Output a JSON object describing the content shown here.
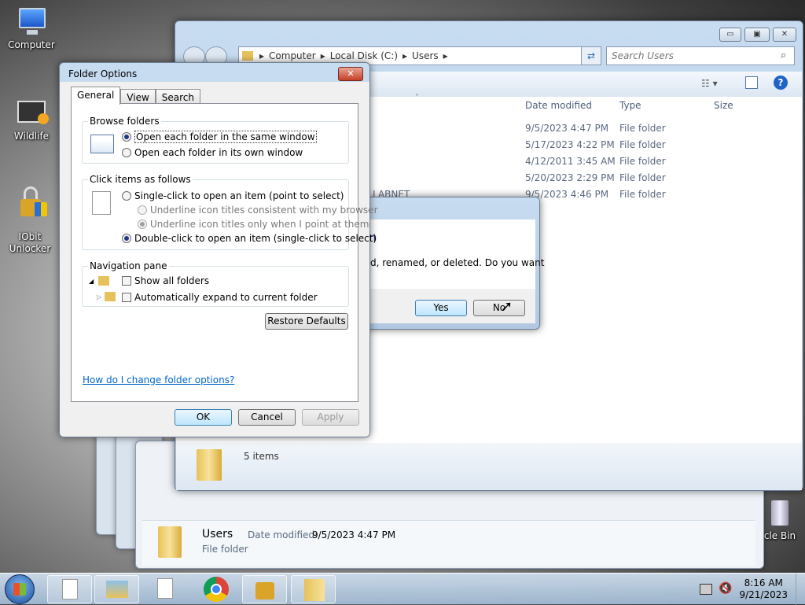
{
  "desktop": {
    "icons": [
      {
        "label": "Computer"
      },
      {
        "label": "Wildlife"
      },
      {
        "label": "IObit\nUnlocker"
      },
      {
        "label": "cle Bin"
      }
    ]
  },
  "explorer": {
    "breadcrumb": [
      "Computer",
      "Local Disk (C:)",
      "Users"
    ],
    "search_placeholder": "Search Users",
    "columns": {
      "date": "Date modified",
      "type": "Type",
      "size": "Size"
    },
    "rows": [
      {
        "name": "",
        "date": "9/5/2023 4:47 PM",
        "type": "File folder"
      },
      {
        "name": "",
        "date": "5/17/2023 4:22 PM",
        "type": "File folder"
      },
      {
        "name": "",
        "date": "4/12/2011 3:45 AM",
        "type": "File folder"
      },
      {
        "name": "",
        "date": "5/20/2023 2:29 PM",
        "type": "File folder"
      },
      {
        "name": "LABNET",
        "date": "9/5/2023 4:46 PM",
        "type": "File folder"
      }
    ],
    "status": "5 items"
  },
  "back_window": {
    "name": "Users",
    "modified_label": "Date modified:",
    "modified_value": "9/5/2023 4:47 PM",
    "type": "File folder"
  },
  "confirm": {
    "title_fragment": "n",
    "message_fragment": "d, renamed, or deleted. Do you want",
    "yes": "Yes",
    "no": "No"
  },
  "folder_options": {
    "title": "Folder Options",
    "tabs": [
      "General",
      "View",
      "Search"
    ],
    "browse": {
      "title": "Browse folders",
      "opt1": "Open each folder in the same window",
      "opt2": "Open each folder in its own window"
    },
    "click": {
      "title": "Click items as follows",
      "single": "Single-click to open an item (point to select)",
      "sub1": "Underline icon titles consistent with my browser",
      "sub2": "Underline icon titles only when I point at them",
      "double": "Double-click to open an item (single-click to select)"
    },
    "nav": {
      "title": "Navigation pane",
      "show_all": "Show all folders",
      "auto_expand": "Automatically expand to current folder"
    },
    "restore": "Restore Defaults",
    "help_link": "How do I change folder options?",
    "ok": "OK",
    "cancel": "Cancel",
    "apply": "Apply"
  },
  "taskbar": {
    "time": "8:16 AM",
    "date": "9/21/2023"
  }
}
